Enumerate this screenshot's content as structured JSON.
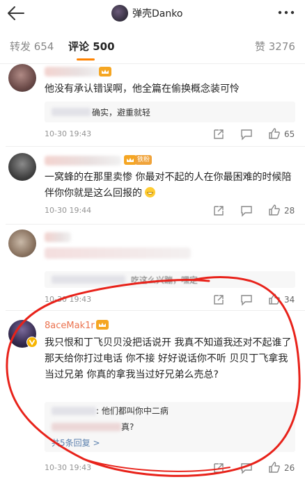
{
  "header": {
    "back_icon": "arrow-left-icon",
    "title": "弹壳Danko",
    "more_icon": "more-dots-icon"
  },
  "tabs": [
    {
      "label": "转发 654"
    },
    {
      "label": "评论 500",
      "active": true
    },
    {
      "label": "赞 3276"
    }
  ],
  "comments": [
    {
      "text": "他没有承认错误啊，他全篇在偷换概念装可怜",
      "reply_text": "确实，避重就轻",
      "time": "10-30 19:43",
      "likes": "65"
    },
    {
      "badge": "铁粉",
      "text": "一窝蜂的在那里卖惨 你最对不起的人在你最困难的时候陪伴你你就是这么回报的",
      "emoji": "grin-emoji",
      "time": "10-30 19:44",
      "likes": "28"
    },
    {
      "reply_text": "吃这么兴蹦，嘿定",
      "time": "10-30 19:43",
      "likes": "34"
    },
    {
      "name": "8aceMak1r",
      "text": "我只恨和丁飞贝贝没把话说开 我真不知道我还对不起谁了 那天给你打过电话 你不接 好好说话你不听 贝贝丁飞拿我当过兄弟 你真的拿我当过好兄弟么売总?",
      "reply_1": ": 他们都叫你中二病",
      "reply_2": "真?",
      "more_replies": "共5条回复 >",
      "time": "10-30 19:43",
      "likes": "26"
    }
  ],
  "colors": {
    "accent": "#ff8200",
    "annotation": "#e8221a",
    "link": "#5a7fad"
  }
}
